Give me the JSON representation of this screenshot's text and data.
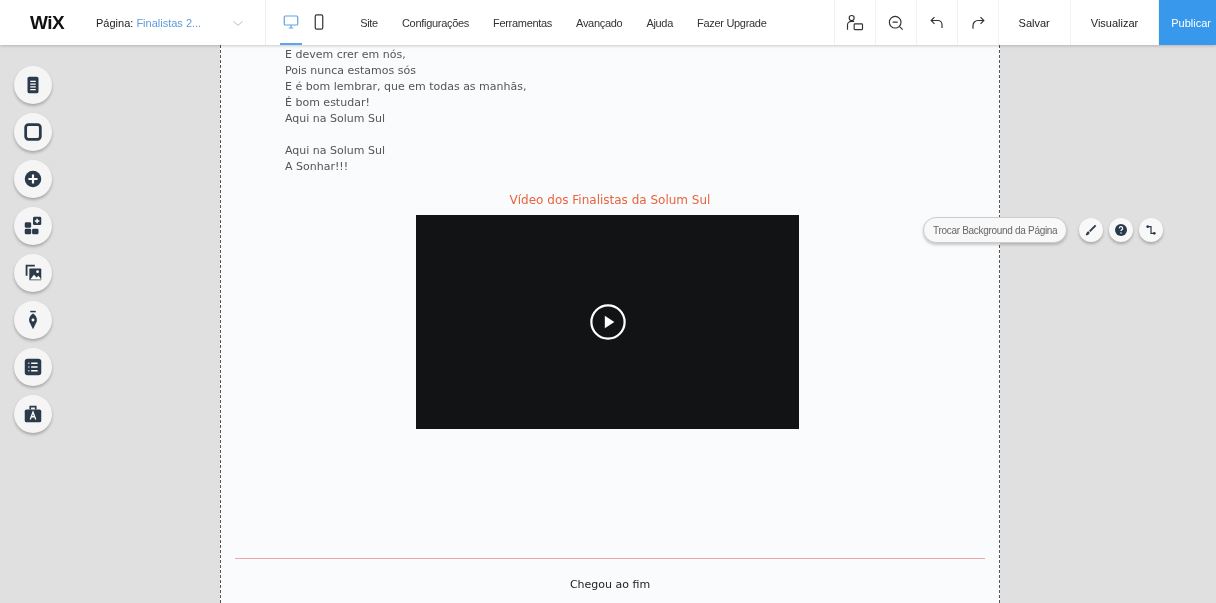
{
  "topbar": {
    "logo": "WiX",
    "page_selector": {
      "label": "Página:",
      "value": "Finalistas 2..."
    },
    "devices": [
      {
        "kind": "desktop",
        "selected": true
      },
      {
        "kind": "mobile",
        "selected": false
      }
    ],
    "menu": [
      "Site",
      "Configurações",
      "Ferramentas",
      "Avançado",
      "Ajuda",
      "Fazer Upgrade"
    ],
    "tools": [
      {
        "kind": "accessibility"
      },
      {
        "kind": "zoom"
      },
      {
        "kind": "undo"
      },
      {
        "kind": "redo"
      }
    ],
    "buttons": [
      {
        "label": "Salvar",
        "kind": "text"
      },
      {
        "label": "Visualizar",
        "kind": "text"
      },
      {
        "label": "Publicar",
        "kind": "primary"
      }
    ]
  },
  "sidebar": {
    "tools": [
      {
        "kind": "pages"
      },
      {
        "kind": "background"
      },
      {
        "kind": "add"
      },
      {
        "kind": "apps"
      },
      {
        "kind": "media"
      },
      {
        "kind": "blog"
      },
      {
        "kind": "list"
      },
      {
        "kind": "store"
      }
    ]
  },
  "page": {
    "stanzas": [
      [
        "E devem crer em nós,",
        "Pois nunca estamos sós",
        "E é bom lembrar, que em todas as manhãs,",
        "É bom estudar!",
        "Aqui na Solum Sul"
      ],
      [
        "Aqui na Solum Sul",
        "A Sonhar!!!"
      ]
    ],
    "video_title": "Vídeo dos Finalistas da Solum Sul",
    "footer_text": "Chegou ao fim"
  },
  "page_actions": {
    "background_button": "Trocar Background da Página",
    "icons": [
      {
        "kind": "brush"
      },
      {
        "kind": "help"
      },
      {
        "kind": "link"
      }
    ]
  }
}
